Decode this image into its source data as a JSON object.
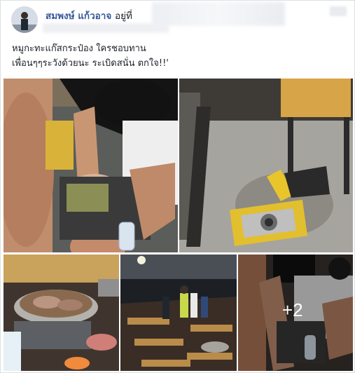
{
  "post": {
    "author_name": "สมพงษ์ แก้วอาจ",
    "author_suffix": "อยู่ที่",
    "caption_lines": [
      "หมูกะทะแก๊สกระป๋อง ใครชอบทาน",
      "เพื่อนๆๆระวังด้วยนะ ระเบิดสนั่น ตกใจ!!'"
    ]
  },
  "photos": {
    "items": [
      {
        "icon": "photo-first-aid-scene"
      },
      {
        "icon": "photo-exploded-stove"
      },
      {
        "icon": "photo-hotpot-table"
      },
      {
        "icon": "photo-restaurant-crowd"
      },
      {
        "icon": "photo-more-scene"
      }
    ],
    "more_count": "+2"
  },
  "colors": {
    "author_link": "#385898",
    "text": "#1d2129",
    "border": "#dddfe2",
    "stove_yellow": "#e8c52a"
  }
}
